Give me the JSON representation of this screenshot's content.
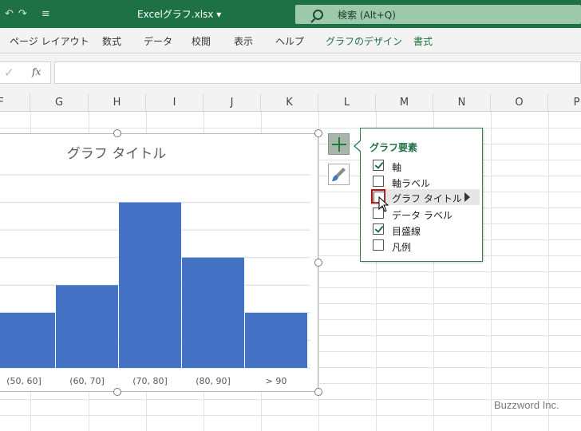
{
  "window": {
    "filename": "Excelグラフ.xlsx ▾",
    "search_placeholder": "検索 (Alt+Q)"
  },
  "ribbon": {
    "tabs": [
      {
        "label": "ページ レイアウト"
      },
      {
        "label": "数式"
      },
      {
        "label": "データ"
      },
      {
        "label": "校閲"
      },
      {
        "label": "表示"
      },
      {
        "label": "ヘルプ"
      },
      {
        "label": "グラフのデザイン"
      },
      {
        "label": "書式"
      }
    ]
  },
  "formula_bar": {
    "fx_label": "fx",
    "value": ""
  },
  "columns": [
    "F",
    "G",
    "H",
    "I",
    "J",
    "K",
    "L",
    "M",
    "N",
    "O",
    "P"
  ],
  "chart_data": {
    "type": "bar",
    "title": "グラフ タイトル",
    "categories": [
      "(50, 60]",
      "(60, 70]",
      "(70, 80]",
      "(80, 90]",
      "> 90"
    ],
    "values": [
      2,
      3,
      6,
      4,
      2
    ],
    "ylim": [
      0,
      7
    ],
    "grid": true,
    "color": "#4472c4"
  },
  "chart_elements": {
    "header": "グラフ要素",
    "items": [
      {
        "label": "軸",
        "checked": true
      },
      {
        "label": "軸ラベル",
        "checked": false
      },
      {
        "label": "グラフ タイトル",
        "checked": false,
        "hover": true
      },
      {
        "label": "データ ラベル",
        "checked": false
      },
      {
        "label": "目盛線",
        "checked": true
      },
      {
        "label": "凡例",
        "checked": false
      }
    ]
  },
  "watermark": "Buzzword Inc."
}
